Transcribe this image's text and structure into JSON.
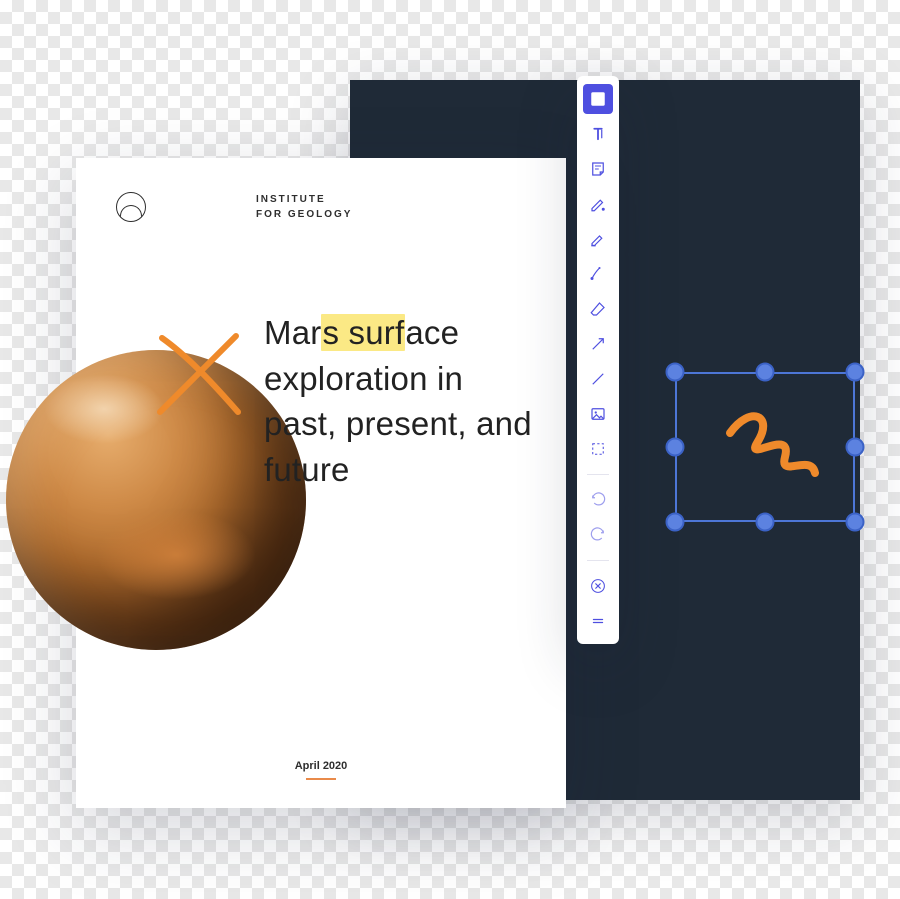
{
  "doc": {
    "org_line1": "INSTITUTE",
    "org_line2": "FOR GEOLOGY",
    "title_pre": "Mar",
    "title_hl": "s surf",
    "title_post": "ace exploration in past, present, and future",
    "date": "April 2020"
  },
  "toolbar": {
    "items": [
      {
        "name": "text-box-tool",
        "active": true
      },
      {
        "name": "text-cursor-tool",
        "active": false
      },
      {
        "name": "note-tool",
        "active": false
      },
      {
        "name": "pen-tool",
        "active": false
      },
      {
        "name": "highlighter-tool",
        "active": false
      },
      {
        "name": "ink-tool",
        "active": false
      },
      {
        "name": "eraser-tool",
        "active": false
      },
      {
        "name": "arrow-tool",
        "active": false
      },
      {
        "name": "line-tool",
        "active": false
      },
      {
        "name": "image-tool",
        "active": false
      },
      {
        "name": "crop-tool",
        "active": false
      }
    ],
    "history": [
      {
        "name": "undo-button"
      },
      {
        "name": "redo-button"
      }
    ],
    "footer": [
      {
        "name": "close-button"
      },
      {
        "name": "drag-handle"
      }
    ]
  },
  "colors": {
    "accent": "#4e4fe0",
    "highlight": "#fbe985",
    "annotation": "#ef8a2b",
    "canvas": "#1f2a37",
    "selection": "#4d76d6"
  }
}
